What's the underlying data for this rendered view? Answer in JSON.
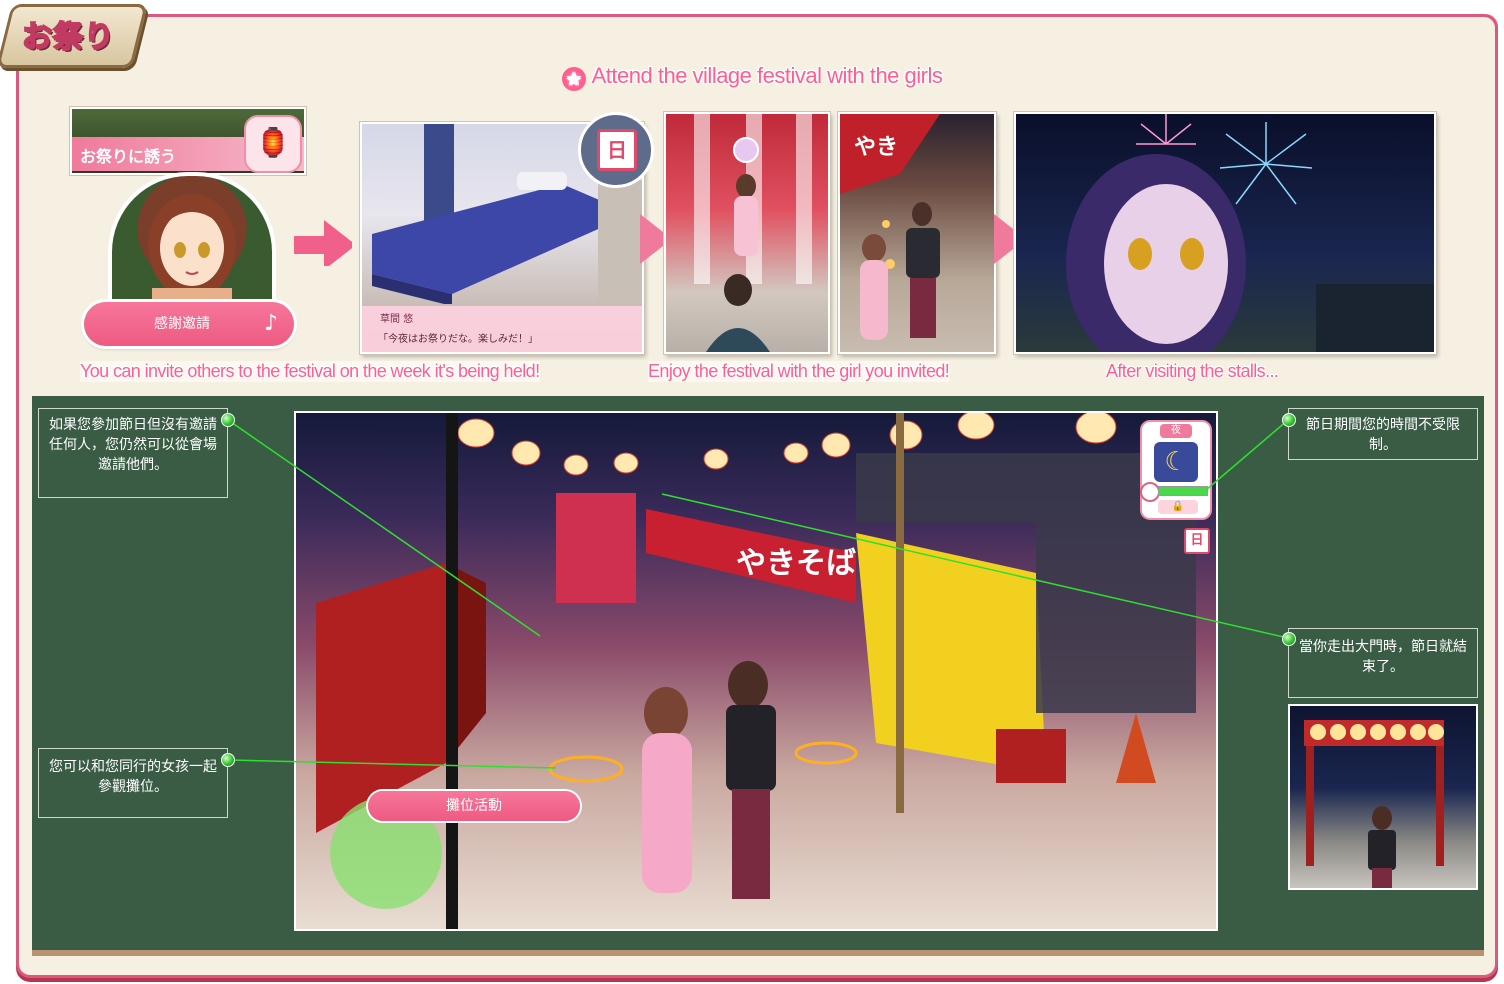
{
  "title": "お祭り",
  "headline": "Attend the village festival with the girls",
  "invite_panel": {
    "label": "お祭りに誘う",
    "button_label": "感謝邀請",
    "icon": "lantern-icon"
  },
  "dialogue": {
    "speaker": "草間 悠",
    "line": "「今夜はお祭りだな。楽しみだ！」",
    "calendar_day": "日"
  },
  "captions": {
    "invite": "You can invite others to the festival on the week it's being held!",
    "enjoy": "Enjoy the festival with the girl you invited!",
    "after": "After visiting the stalls..."
  },
  "notes": {
    "invite_from_venue": "如果您參加節日但沒有邀請任何人，您仍然可以從會場邀請他們。",
    "browse_stalls": "您可以和您同行的女孩一起參觀攤位。",
    "time_unlimited": "節日期間您的時間不受限制。",
    "leave_gate": "當你走出大門時，節日就結束了。"
  },
  "hud": {
    "time_label": "夜",
    "calendar_day": "日",
    "stall_button": "攤位活動"
  },
  "stall_signs": [
    "やきそば"
  ],
  "colors": {
    "accent_pink": "#ff5e8f",
    "board_green": "#3a5c45",
    "frame_pink": "#d9597f"
  }
}
